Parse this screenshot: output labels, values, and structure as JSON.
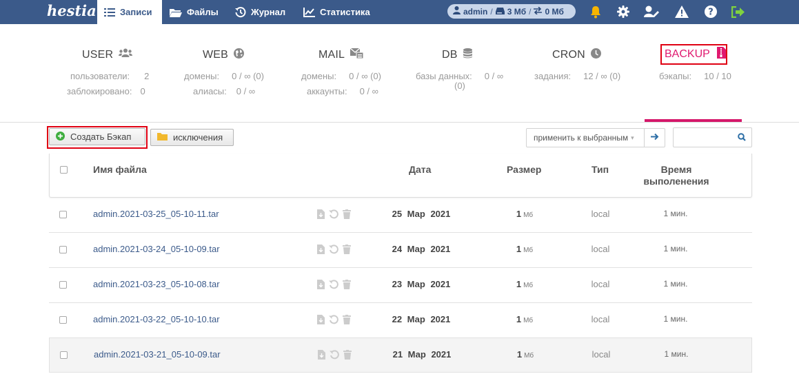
{
  "nav": {
    "logo_text": "hestia",
    "items": [
      {
        "label": "Записи",
        "icon": "list-icon",
        "active": true
      },
      {
        "label": "Файлы",
        "icon": "folder-icon",
        "active": false
      },
      {
        "label": "Журнал",
        "icon": "history-icon",
        "active": false
      },
      {
        "label": "Статистика",
        "icon": "chart-icon",
        "active": false
      }
    ],
    "user_pill": {
      "user": "admin",
      "disk": "3 Мб",
      "bandwidth": "0 Мб",
      "sep": "/"
    },
    "tools": [
      "bell-icon",
      "gear-icon",
      "user-edit-icon",
      "warning-icon",
      "help-icon",
      "logout-icon"
    ],
    "accent_color": "#3b5a8a",
    "bell_color": "#f7b500",
    "logout_color": "#7fd23f"
  },
  "stats": {
    "user": {
      "title": "USER",
      "lines": [
        {
          "label": "пользователи:",
          "value": "2"
        },
        {
          "label": "заблокировано:",
          "value": "0"
        }
      ]
    },
    "web": {
      "title": "WEB",
      "lines": [
        {
          "label": "домены:",
          "value": "0 / ∞ (0)"
        },
        {
          "label": "алиасы:",
          "value": "0 / ∞"
        }
      ]
    },
    "mail": {
      "title": "MAIL",
      "lines": [
        {
          "label": "домены:",
          "value": "0 / ∞ (0)"
        },
        {
          "label": "аккаунты:",
          "value": "0 / ∞"
        }
      ]
    },
    "db": {
      "title": "DB",
      "lines": [
        {
          "label": "базы данных:",
          "value": "0 / ∞"
        },
        {
          "label": "",
          "value": "(0)"
        }
      ]
    },
    "cron": {
      "title": "CRON",
      "lines": [
        {
          "label": "задания:",
          "value": "12 / ∞ (0)"
        }
      ]
    },
    "backup": {
      "title": "BACKUP",
      "lines": [
        {
          "label": "бэкапы:",
          "value": "10 / 10"
        }
      ],
      "active_color": "#d5176a"
    }
  },
  "toolbar": {
    "create_label": "Создать Бэкап",
    "exclusions_label": "исключения",
    "bulk_placeholder": "применить к выбранным",
    "search_placeholder": ""
  },
  "table": {
    "headers": {
      "name": "Имя файла",
      "date": "Дата",
      "size": "Размер",
      "type": "Тип",
      "time_1": "Время",
      "time_2": "выполенения"
    },
    "rows": [
      {
        "name": "admin.2021-03-25_05-10-11.tar",
        "date": "25 Мар 2021",
        "size": "1",
        "unit": "Мб",
        "type": "local",
        "time": "1 мин."
      },
      {
        "name": "admin.2021-03-24_05-10-09.tar",
        "date": "24 Мар 2021",
        "size": "1",
        "unit": "Мб",
        "type": "local",
        "time": "1 мин."
      },
      {
        "name": "admin.2021-03-23_05-10-08.tar",
        "date": "23 Мар 2021",
        "size": "1",
        "unit": "Мб",
        "type": "local",
        "time": "1 мин."
      },
      {
        "name": "admin.2021-03-22_05-10-10.tar",
        "date": "22 Мар 2021",
        "size": "1",
        "unit": "Мб",
        "type": "local",
        "time": "1 мин."
      },
      {
        "name": "admin.2021-03-21_05-10-09.tar",
        "date": "21 Мар 2021",
        "size": "1",
        "unit": "Мб",
        "type": "local",
        "time": "1 мин."
      }
    ]
  }
}
